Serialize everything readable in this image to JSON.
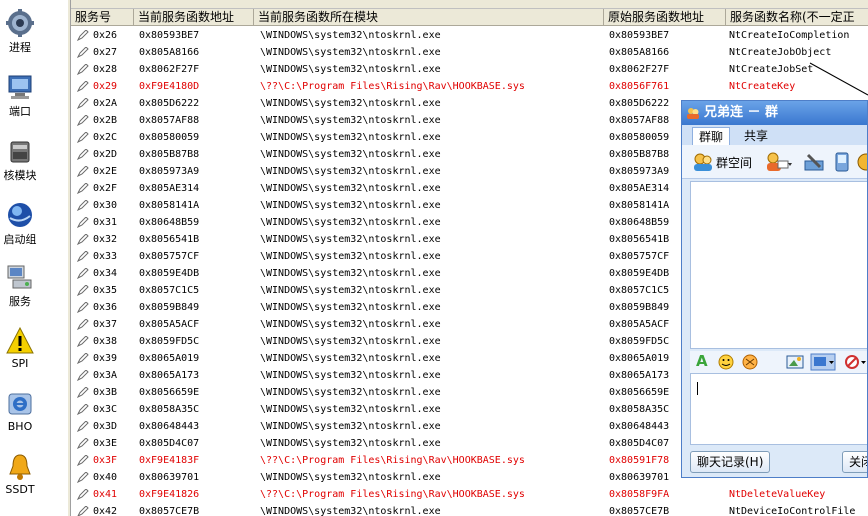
{
  "sidebar": {
    "items": [
      {
        "label": "进程",
        "icon": "gear-icon"
      },
      {
        "label": "端口",
        "icon": "network-icon"
      },
      {
        "label": "核模块",
        "icon": "module-icon"
      },
      {
        "label": "启动组",
        "icon": "globe-icon"
      },
      {
        "label": "服务",
        "icon": "service-icon"
      },
      {
        "label": "SPI",
        "icon": "warning-icon"
      },
      {
        "label": "BHO",
        "icon": "ie-icon"
      },
      {
        "label": "SSDT",
        "icon": "bell-icon"
      }
    ]
  },
  "table": {
    "columns": [
      "服务号",
      "当前服务函数地址",
      "当前服务函数所在模块",
      "原始服务函数地址",
      "服务函数名称(不一定正"
    ],
    "rows": [
      {
        "id": "0x26",
        "cur": "0x80593BE7",
        "module": "\\WINDOWS\\system32\\ntoskrnl.exe",
        "orig": "0x80593BE7",
        "name": "NtCreateIoCompletion",
        "hooked": false
      },
      {
        "id": "0x27",
        "cur": "0x805A8166",
        "module": "\\WINDOWS\\system32\\ntoskrnl.exe",
        "orig": "0x805A8166",
        "name": "NtCreateJobObject",
        "hooked": false
      },
      {
        "id": "0x28",
        "cur": "0x8062F27F",
        "module": "\\WINDOWS\\system32\\ntoskrnl.exe",
        "orig": "0x8062F27F",
        "name": "NtCreateJobSet",
        "hooked": false
      },
      {
        "id": "0x29",
        "cur": "0xF9E4180D",
        "module": "\\??\\C:\\Program Files\\Rising\\Rav\\HOOKBASE.sys",
        "orig": "0x8056F761",
        "name": "NtCreateKey",
        "hooked": true
      },
      {
        "id": "0x2A",
        "cur": "0x805D6222",
        "module": "\\WINDOWS\\system32\\ntoskrnl.exe",
        "orig": "0x805D6222",
        "name": "",
        "hooked": false
      },
      {
        "id": "0x2B",
        "cur": "0x8057AF88",
        "module": "\\WINDOWS\\system32\\ntoskrnl.exe",
        "orig": "0x8057AF88",
        "name": "",
        "hooked": false
      },
      {
        "id": "0x2C",
        "cur": "0x80580059",
        "module": "\\WINDOWS\\system32\\ntoskrnl.exe",
        "orig": "0x80580059",
        "name": "",
        "hooked": false
      },
      {
        "id": "0x2D",
        "cur": "0x805B87B8",
        "module": "\\WINDOWS\\system32\\ntoskrnl.exe",
        "orig": "0x805B87B8",
        "name": "",
        "hooked": false
      },
      {
        "id": "0x2E",
        "cur": "0x805973A9",
        "module": "\\WINDOWS\\system32\\ntoskrnl.exe",
        "orig": "0x805973A9",
        "name": "",
        "hooked": false
      },
      {
        "id": "0x2F",
        "cur": "0x805AE314",
        "module": "\\WINDOWS\\system32\\ntoskrnl.exe",
        "orig": "0x805AE314",
        "name": "",
        "hooked": false
      },
      {
        "id": "0x30",
        "cur": "0x8058141A",
        "module": "\\WINDOWS\\system32\\ntoskrnl.exe",
        "orig": "0x8058141A",
        "name": "",
        "hooked": false
      },
      {
        "id": "0x31",
        "cur": "0x80648B59",
        "module": "\\WINDOWS\\system32\\ntoskrnl.exe",
        "orig": "0x80648B59",
        "name": "",
        "hooked": false
      },
      {
        "id": "0x32",
        "cur": "0x8056541B",
        "module": "\\WINDOWS\\system32\\ntoskrnl.exe",
        "orig": "0x8056541B",
        "name": "",
        "hooked": false
      },
      {
        "id": "0x33",
        "cur": "0x805757CF",
        "module": "\\WINDOWS\\system32\\ntoskrnl.exe",
        "orig": "0x805757CF",
        "name": "",
        "hooked": false
      },
      {
        "id": "0x34",
        "cur": "0x8059E4DB",
        "module": "\\WINDOWS\\system32\\ntoskrnl.exe",
        "orig": "0x8059E4DB",
        "name": "",
        "hooked": false
      },
      {
        "id": "0x35",
        "cur": "0x8057C1C5",
        "module": "\\WINDOWS\\system32\\ntoskrnl.exe",
        "orig": "0x8057C1C5",
        "name": "",
        "hooked": false
      },
      {
        "id": "0x36",
        "cur": "0x8059B849",
        "module": "\\WINDOWS\\system32\\ntoskrnl.exe",
        "orig": "0x8059B849",
        "name": "",
        "hooked": false
      },
      {
        "id": "0x37",
        "cur": "0x805A5ACF",
        "module": "\\WINDOWS\\system32\\ntoskrnl.exe",
        "orig": "0x805A5ACF",
        "name": "",
        "hooked": false
      },
      {
        "id": "0x38",
        "cur": "0x8059FD5C",
        "module": "\\WINDOWS\\system32\\ntoskrnl.exe",
        "orig": "0x8059FD5C",
        "name": "",
        "hooked": false
      },
      {
        "id": "0x39",
        "cur": "0x8065A019",
        "module": "\\WINDOWS\\system32\\ntoskrnl.exe",
        "orig": "0x8065A019",
        "name": "",
        "hooked": false
      },
      {
        "id": "0x3A",
        "cur": "0x8065A173",
        "module": "\\WINDOWS\\system32\\ntoskrnl.exe",
        "orig": "0x8065A173",
        "name": "",
        "hooked": false
      },
      {
        "id": "0x3B",
        "cur": "0x8056659E",
        "module": "\\WINDOWS\\system32\\ntoskrnl.exe",
        "orig": "0x8056659E",
        "name": "",
        "hooked": false
      },
      {
        "id": "0x3C",
        "cur": "0x8058A35C",
        "module": "\\WINDOWS\\system32\\ntoskrnl.exe",
        "orig": "0x8058A35C",
        "name": "",
        "hooked": false
      },
      {
        "id": "0x3D",
        "cur": "0x80648443",
        "module": "\\WINDOWS\\system32\\ntoskrnl.exe",
        "orig": "0x80648443",
        "name": "",
        "hooked": false
      },
      {
        "id": "0x3E",
        "cur": "0x805D4C07",
        "module": "\\WINDOWS\\system32\\ntoskrnl.exe",
        "orig": "0x805D4C07",
        "name": "",
        "hooked": false
      },
      {
        "id": "0x3F",
        "cur": "0xF9E4183F",
        "module": "\\??\\C:\\Program Files\\Rising\\Rav\\HOOKBASE.sys",
        "orig": "0x80591F78",
        "name": "",
        "hooked": true
      },
      {
        "id": "0x40",
        "cur": "0x80639701",
        "module": "\\WINDOWS\\system32\\ntoskrnl.exe",
        "orig": "0x80639701",
        "name": "",
        "hooked": false
      },
      {
        "id": "0x41",
        "cur": "0xF9E41826",
        "module": "\\??\\C:\\Program Files\\Rising\\Rav\\HOOKBASE.sys",
        "orig": "0x8058F9FA",
        "name": "NtDeleteValueKey",
        "hooked": true
      },
      {
        "id": "0x42",
        "cur": "0x8057CE7B",
        "module": "\\WINDOWS\\system32\\ntoskrnl.exe",
        "orig": "0x8057CE7B",
        "name": "NtDeviceIoControlFile",
        "hooked": false
      }
    ]
  },
  "chat": {
    "title": "兄弟连 － 群",
    "tabs": [
      "群聊",
      "共享"
    ],
    "toolbar_space_label": "群空间",
    "history_button": "聊天记录(H)",
    "close_button": "关闭"
  },
  "colors": {
    "hooked_text": "#e00000",
    "chat_title_bar": "#3a77cf",
    "header_bg": "#ece9d8"
  }
}
